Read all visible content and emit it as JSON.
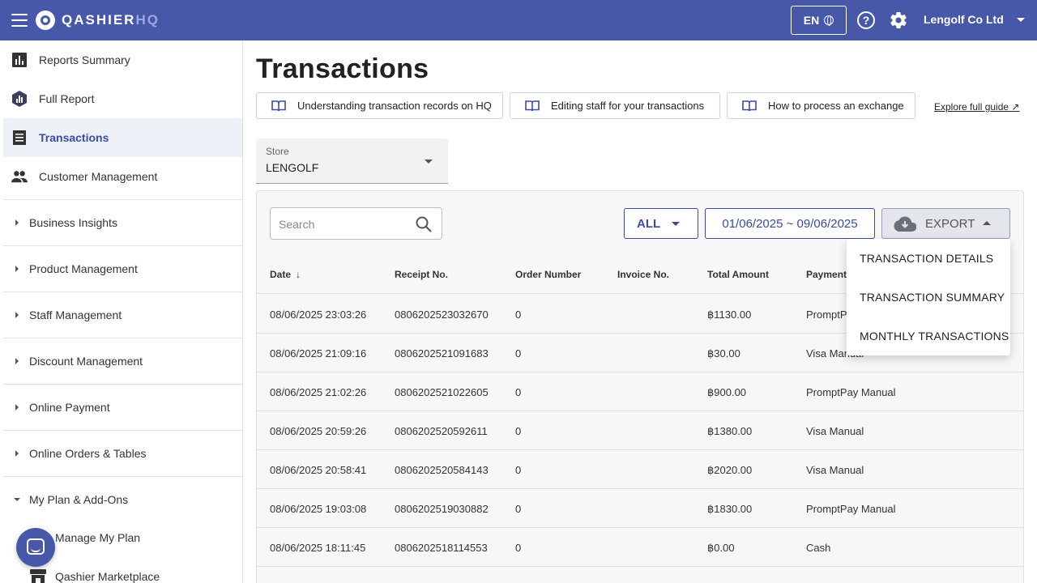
{
  "topbar": {
    "logo_main": "QASHIER",
    "logo_accent": "HQ",
    "language": "EN",
    "account_name": "Lengolf Co Ltd"
  },
  "sidebar": {
    "items": [
      {
        "label": "Reports Summary",
        "icon": "bar-chart-icon"
      },
      {
        "label": "Full Report",
        "icon": "report-hexagon-icon"
      },
      {
        "label": "Transactions",
        "icon": "receipt-icon",
        "active": true
      },
      {
        "label": "Customer Management",
        "icon": "people-icon"
      }
    ],
    "groups": [
      {
        "label": "Business Insights"
      },
      {
        "label": "Product Management"
      },
      {
        "label": "Staff Management"
      },
      {
        "label": "Discount Management"
      },
      {
        "label": "Online Payment"
      },
      {
        "label": "Online Orders & Tables"
      },
      {
        "label": "My Plan & Add-Ons",
        "expanded": true
      }
    ],
    "subitems": [
      {
        "label": "Manage My Plan"
      },
      {
        "label": "Qashier Marketplace",
        "icon": "store-icon"
      }
    ]
  },
  "main": {
    "title": "Transactions",
    "guides": [
      {
        "label": "Understanding transaction records on HQ"
      },
      {
        "label": "Editing staff for your transactions"
      },
      {
        "label": "How to process an exchange"
      }
    ],
    "explore_link": "Explore full guide",
    "store": {
      "caption": "Store",
      "value": "LENGOLF"
    },
    "search": {
      "placeholder": "Search"
    },
    "filter": {
      "label": "ALL"
    },
    "date_range": "01/06/2025 ~ 09/06/2025",
    "export": {
      "label": "EXPORT",
      "menu": [
        "TRANSACTION DETAILS",
        "TRANSACTION SUMMARY",
        "MONTHLY TRANSACTIONS"
      ]
    },
    "table": {
      "headers": [
        "Date",
        "Receipt No.",
        "Order Number",
        "Invoice No.",
        "Total Amount",
        "Payment"
      ],
      "rows": [
        [
          "08/06/2025 23:03:26",
          "0806202523032670",
          "0",
          "",
          "฿1130.00",
          "PromptPay Manual"
        ],
        [
          "08/06/2025 21:09:16",
          "0806202521091683",
          "0",
          "",
          "฿30.00",
          "Visa Manual"
        ],
        [
          "08/06/2025 21:02:26",
          "0806202521022605",
          "0",
          "",
          "฿900.00",
          "PromptPay Manual"
        ],
        [
          "08/06/2025 20:59:26",
          "0806202520592611",
          "0",
          "",
          "฿1380.00",
          "Visa Manual"
        ],
        [
          "08/06/2025 20:58:41",
          "0806202520584143",
          "0",
          "",
          "฿2020.00",
          "Visa Manual"
        ],
        [
          "08/06/2025 19:03:08",
          "0806202519030882",
          "0",
          "",
          "฿1830.00",
          "PromptPay Manual"
        ],
        [
          "08/06/2025 18:11:45",
          "0806202518114553",
          "0",
          "",
          "฿0.00",
          "Cash"
        ]
      ]
    }
  },
  "colors": {
    "brand": "#4758a8",
    "accent_text": "#3c4b9a"
  }
}
